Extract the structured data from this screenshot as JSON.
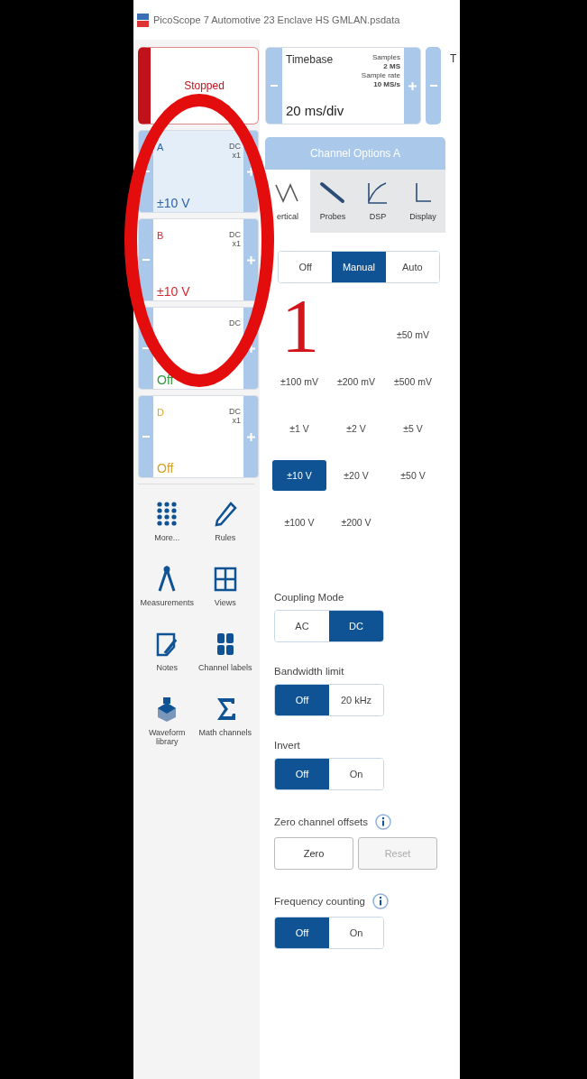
{
  "window": {
    "title": "PicoScope 7 Automotive 23 Enclave HS GMLAN.psdata"
  },
  "run_button": {
    "label": "Stopped"
  },
  "timebase": {
    "label": "Timebase",
    "value": "20 ms/div",
    "samples_label": "Samples",
    "samples": "2 MS",
    "sample_rate_label": "Sample rate",
    "sample_rate": "10 MS/s"
  },
  "next_card": {
    "label": "T"
  },
  "channels": [
    {
      "name": "A",
      "coupling": "DC",
      "probe": "x1",
      "range": "±10 V",
      "color": "#2a62a8",
      "selected": true
    },
    {
      "name": "B",
      "coupling": "DC",
      "probe": "x1",
      "range": "±10 V",
      "color": "#d8262e",
      "selected": false
    },
    {
      "coupling": "DC",
      "range": "Off",
      "color": "#2f9a3c",
      "selected": false
    },
    {
      "name": "D",
      "coupling": "DC",
      "probe": "x1",
      "range": "Off",
      "color": "#d6a12a",
      "selected": false
    }
  ],
  "tools": [
    {
      "label": "More...",
      "kind": "dots"
    },
    {
      "label": "Rules",
      "kind": "ruler"
    },
    {
      "label": "Measurements",
      "kind": "compass"
    },
    {
      "label": "Views",
      "kind": "grid"
    },
    {
      "label": "Notes",
      "kind": "note"
    },
    {
      "label": "Channel labels",
      "kind": "tag"
    },
    {
      "label": "Waveform library",
      "kind": "stack"
    },
    {
      "label": "Math channels",
      "kind": "sigma"
    }
  ],
  "channel_options": {
    "title": "Channel Options A",
    "tabs": [
      {
        "label": "ertical",
        "kind": "wave",
        "selected": true
      },
      {
        "label": "Probes",
        "kind": "probe",
        "selected": false
      },
      {
        "label": "DSP",
        "kind": "curve",
        "selected": false
      },
      {
        "label": "Display",
        "kind": "axes",
        "selected": false
      }
    ],
    "range_mode": [
      {
        "label": "Off",
        "selected": false
      },
      {
        "label": "Manual",
        "selected": true
      },
      {
        "label": "Auto",
        "selected": false
      }
    ],
    "ranges": [
      {
        "label": "±50 mV",
        "selected": false
      },
      {
        "label": "±100 mV",
        "selected": false
      },
      {
        "label": "±200 mV",
        "selected": false
      },
      {
        "label": "±500 mV",
        "selected": false
      },
      {
        "label": "±1 V",
        "selected": false
      },
      {
        "label": "±2 V",
        "selected": false
      },
      {
        "label": "±5 V",
        "selected": false
      },
      {
        "label": "±10 V",
        "selected": true
      },
      {
        "label": "±20 V",
        "selected": false
      },
      {
        "label": "±50 V",
        "selected": false
      },
      {
        "label": "±100 V",
        "selected": false
      },
      {
        "label": "±200 V",
        "selected": false
      }
    ],
    "sections": [
      {
        "label": "Coupling Mode",
        "kind": "toggle",
        "info": false,
        "options": [
          {
            "label": "AC",
            "selected": false
          },
          {
            "label": "DC",
            "selected": true
          }
        ]
      },
      {
        "label": "Bandwidth limit",
        "kind": "toggle",
        "info": false,
        "options": [
          {
            "label": "Off",
            "selected": true
          },
          {
            "label": "20 kHz",
            "selected": false
          }
        ]
      },
      {
        "label": "Invert",
        "kind": "toggle",
        "info": false,
        "options": [
          {
            "label": "Off",
            "selected": true
          },
          {
            "label": "On",
            "selected": false
          }
        ]
      },
      {
        "label": "Zero channel offsets",
        "kind": "buttons",
        "info": true,
        "buttons": [
          {
            "label": "Zero",
            "disabled": false
          },
          {
            "label": "Reset",
            "disabled": true
          }
        ]
      },
      {
        "label": "Frequency counting",
        "kind": "toggle",
        "info": true,
        "options": [
          {
            "label": "Off",
            "selected": true
          },
          {
            "label": "On",
            "selected": false
          }
        ]
      }
    ]
  },
  "annotation": {
    "label": "1"
  }
}
